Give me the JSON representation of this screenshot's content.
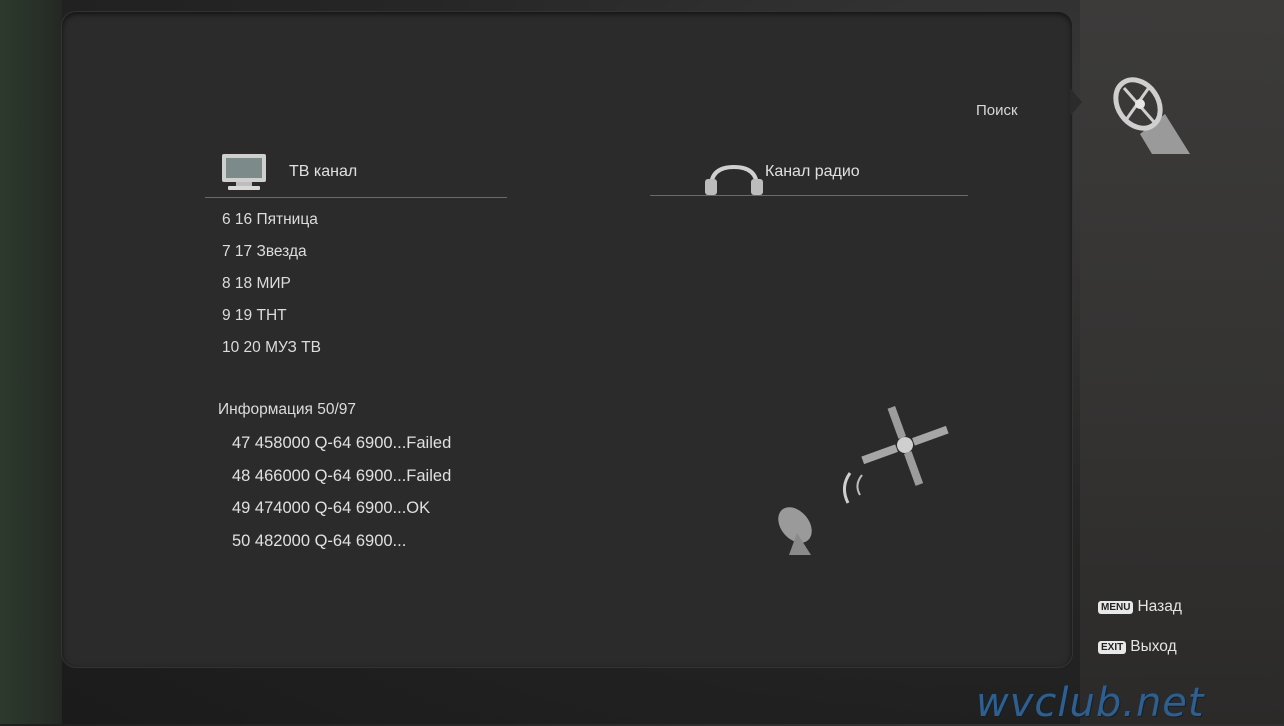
{
  "header": {
    "title": "Поиск"
  },
  "tv": {
    "heading": "ТВ канал",
    "channels": [
      "6 16 Пятница",
      "7 17 Звезда",
      "8 18 МИР",
      "9 19 ТНТ",
      "10 20 МУЗ ТВ"
    ]
  },
  "radio": {
    "heading": "Канал радио"
  },
  "info": {
    "label": "Информация",
    "progress": "50/97",
    "scans": [
      "47 458000 Q-64 6900...Failed",
      "48 466000 Q-64 6900...Failed",
      "49 474000 Q-64 6900...OK",
      "50 482000 Q-64 6900..."
    ]
  },
  "hints": {
    "menu_key": "MENU",
    "back_label": "Назад",
    "exit_key": "EXIT",
    "exit_label": "Выход"
  },
  "watermark": "wvclub.net",
  "icons": {
    "tv": "tv-icon",
    "radio": "headphones-icon",
    "search": "satellite-dish-icon",
    "scan_art": "satellite-signal-icon"
  }
}
